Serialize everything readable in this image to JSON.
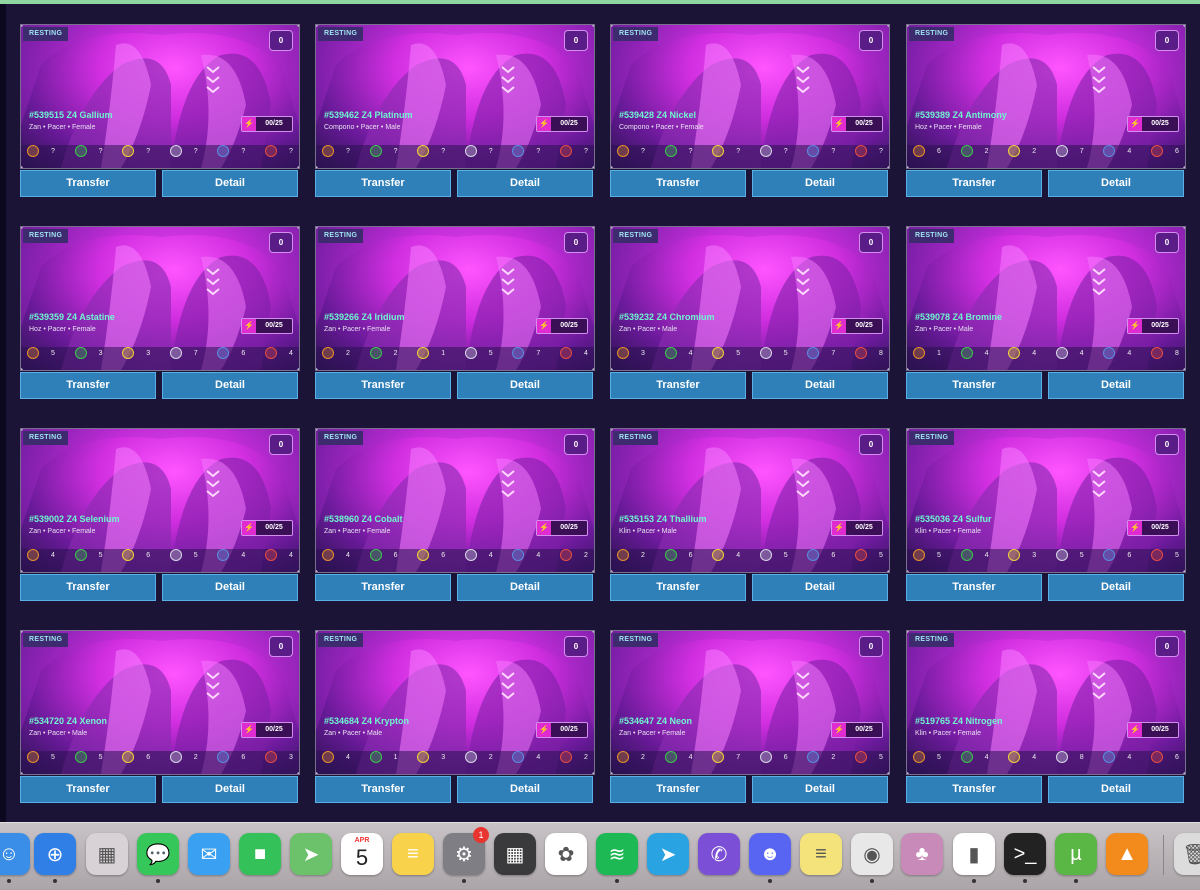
{
  "ui": {
    "tag": "RESTING",
    "favorites": "0",
    "energy": "00/25",
    "transfer_label": "Transfer",
    "detail_label": "Detail",
    "stat_icons": [
      "stat-strength-icon",
      "stat-agility-icon",
      "stat-speed-icon",
      "stat-magic-icon",
      "stat-defense-icon",
      "stat-fire-icon"
    ],
    "stat_colors": [
      "#e6902a",
      "#3dc64e",
      "#f0d23a",
      "#d7d7e6",
      "#5a8ce0",
      "#e44d43"
    ]
  },
  "cards": [
    {
      "name": "#539515 Z4 Gallium",
      "info": "Zan • Pacer • Female",
      "stats": [
        "?",
        "?",
        "?",
        "?",
        "?",
        "?"
      ]
    },
    {
      "name": "#539462 Z4 Platinum",
      "info": "Compono • Pacer • Male",
      "stats": [
        "?",
        "?",
        "?",
        "?",
        "?",
        "?"
      ]
    },
    {
      "name": "#539428 Z4 Nickel",
      "info": "Compono • Pacer • Female",
      "stats": [
        "?",
        "?",
        "?",
        "?",
        "?",
        "?"
      ]
    },
    {
      "name": "#539389 Z4 Antimony",
      "info": "Hoz • Pacer • Female",
      "stats": [
        "6",
        "2",
        "2",
        "7",
        "4",
        "6"
      ]
    },
    {
      "name": "#539359 Z4 Astatine",
      "info": "Hoz • Pacer • Female",
      "stats": [
        "5",
        "3",
        "3",
        "7",
        "6",
        "4"
      ]
    },
    {
      "name": "#539266 Z4 Iridium",
      "info": "Zan • Pacer • Female",
      "stats": [
        "2",
        "2",
        "1",
        "5",
        "7",
        "4"
      ]
    },
    {
      "name": "#539232 Z4 Chromium",
      "info": "Zan • Pacer • Male",
      "stats": [
        "3",
        "4",
        "5",
        "5",
        "7",
        "8"
      ]
    },
    {
      "name": "#539078 Z4 Bromine",
      "info": "Zan • Pacer • Male",
      "stats": [
        "1",
        "4",
        "4",
        "4",
        "4",
        "8"
      ]
    },
    {
      "name": "#539002 Z4 Selenium",
      "info": "Zan • Pacer • Female",
      "stats": [
        "4",
        "5",
        "6",
        "5",
        "4",
        "4"
      ]
    },
    {
      "name": "#538960 Z4 Cobalt",
      "info": "Zan • Pacer • Female",
      "stats": [
        "4",
        "6",
        "6",
        "4",
        "4",
        "2"
      ]
    },
    {
      "name": "#535153 Z4 Thallium",
      "info": "Klin • Pacer • Male",
      "stats": [
        "2",
        "6",
        "4",
        "5",
        "6",
        "5"
      ]
    },
    {
      "name": "#535036 Z4 Sulfur",
      "info": "Klin • Pacer • Female",
      "stats": [
        "5",
        "4",
        "3",
        "5",
        "6",
        "5"
      ]
    },
    {
      "name": "#534720 Z4 Xenon",
      "info": "Zan • Pacer • Male",
      "stats": [
        "5",
        "5",
        "6",
        "2",
        "6",
        "3"
      ]
    },
    {
      "name": "#534684 Z4 Krypton",
      "info": "Zan • Pacer • Male",
      "stats": [
        "4",
        "1",
        "3",
        "2",
        "4",
        "2"
      ]
    },
    {
      "name": "#534647 Z4 Neon",
      "info": "Zan • Pacer • Female",
      "stats": [
        "2",
        "4",
        "7",
        "6",
        "2",
        "5"
      ]
    },
    {
      "name": "#519765 Z4 Nitrogen",
      "info": "Klin • Pacer • Female",
      "stats": [
        "5",
        "4",
        "4",
        "8",
        "4",
        "6"
      ]
    }
  ],
  "dock": {
    "calendar_month": "APR",
    "calendar_day": "5",
    "settings_badge": "1",
    "apps": [
      {
        "name": "finder-icon",
        "color": "#3b8ee8",
        "glyph": "☺"
      },
      {
        "name": "safari-icon",
        "color": "#2f7fe6",
        "glyph": "⊕"
      },
      {
        "name": "launchpad-icon",
        "color": "#d8d2d6",
        "glyph": "▦"
      },
      {
        "name": "messages-icon",
        "color": "#35c759",
        "glyph": "💬"
      },
      {
        "name": "mail-icon",
        "color": "#3aa0f2",
        "glyph": "✉"
      },
      {
        "name": "facetime-icon",
        "color": "#34c15a",
        "glyph": "■"
      },
      {
        "name": "maps-icon",
        "color": "#6cc26a",
        "glyph": "➤"
      },
      {
        "name": "calendar-icon",
        "color": "#ffffff",
        "glyph": ""
      },
      {
        "name": "notes-icon",
        "color": "#f7d24a",
        "glyph": "≡"
      },
      {
        "name": "system-settings-icon",
        "color": "#7e7e84",
        "glyph": "⚙"
      },
      {
        "name": "calculator-icon",
        "color": "#3a3a3c",
        "glyph": "▦"
      },
      {
        "name": "photos-icon",
        "color": "#ffffff",
        "glyph": "✿"
      },
      {
        "name": "spotify-icon",
        "color": "#1db954",
        "glyph": "≋"
      },
      {
        "name": "telegram-icon",
        "color": "#2aa3e3",
        "glyph": "➤"
      },
      {
        "name": "viber-icon",
        "color": "#7b4fd6",
        "glyph": "✆"
      },
      {
        "name": "discord-icon",
        "color": "#5865f2",
        "glyph": "☻"
      },
      {
        "name": "stickies-icon",
        "color": "#f4e27a",
        "glyph": "≡"
      },
      {
        "name": "chrome-icon",
        "color": "#e8e8e8",
        "glyph": "◉"
      },
      {
        "name": "game-app-icon",
        "color": "#c88ab8",
        "glyph": "♣"
      },
      {
        "name": "numbers-icon",
        "color": "#ffffff",
        "glyph": "▮"
      },
      {
        "name": "terminal-icon",
        "color": "#222222",
        "glyph": ">_"
      },
      {
        "name": "utorrent-icon",
        "color": "#5ab645",
        "glyph": "µ"
      },
      {
        "name": "vlc-icon",
        "color": "#f28a1c",
        "glyph": "▲"
      },
      {
        "name": "trash-icon",
        "color": "#dcdcdc",
        "glyph": "🗑"
      }
    ]
  }
}
